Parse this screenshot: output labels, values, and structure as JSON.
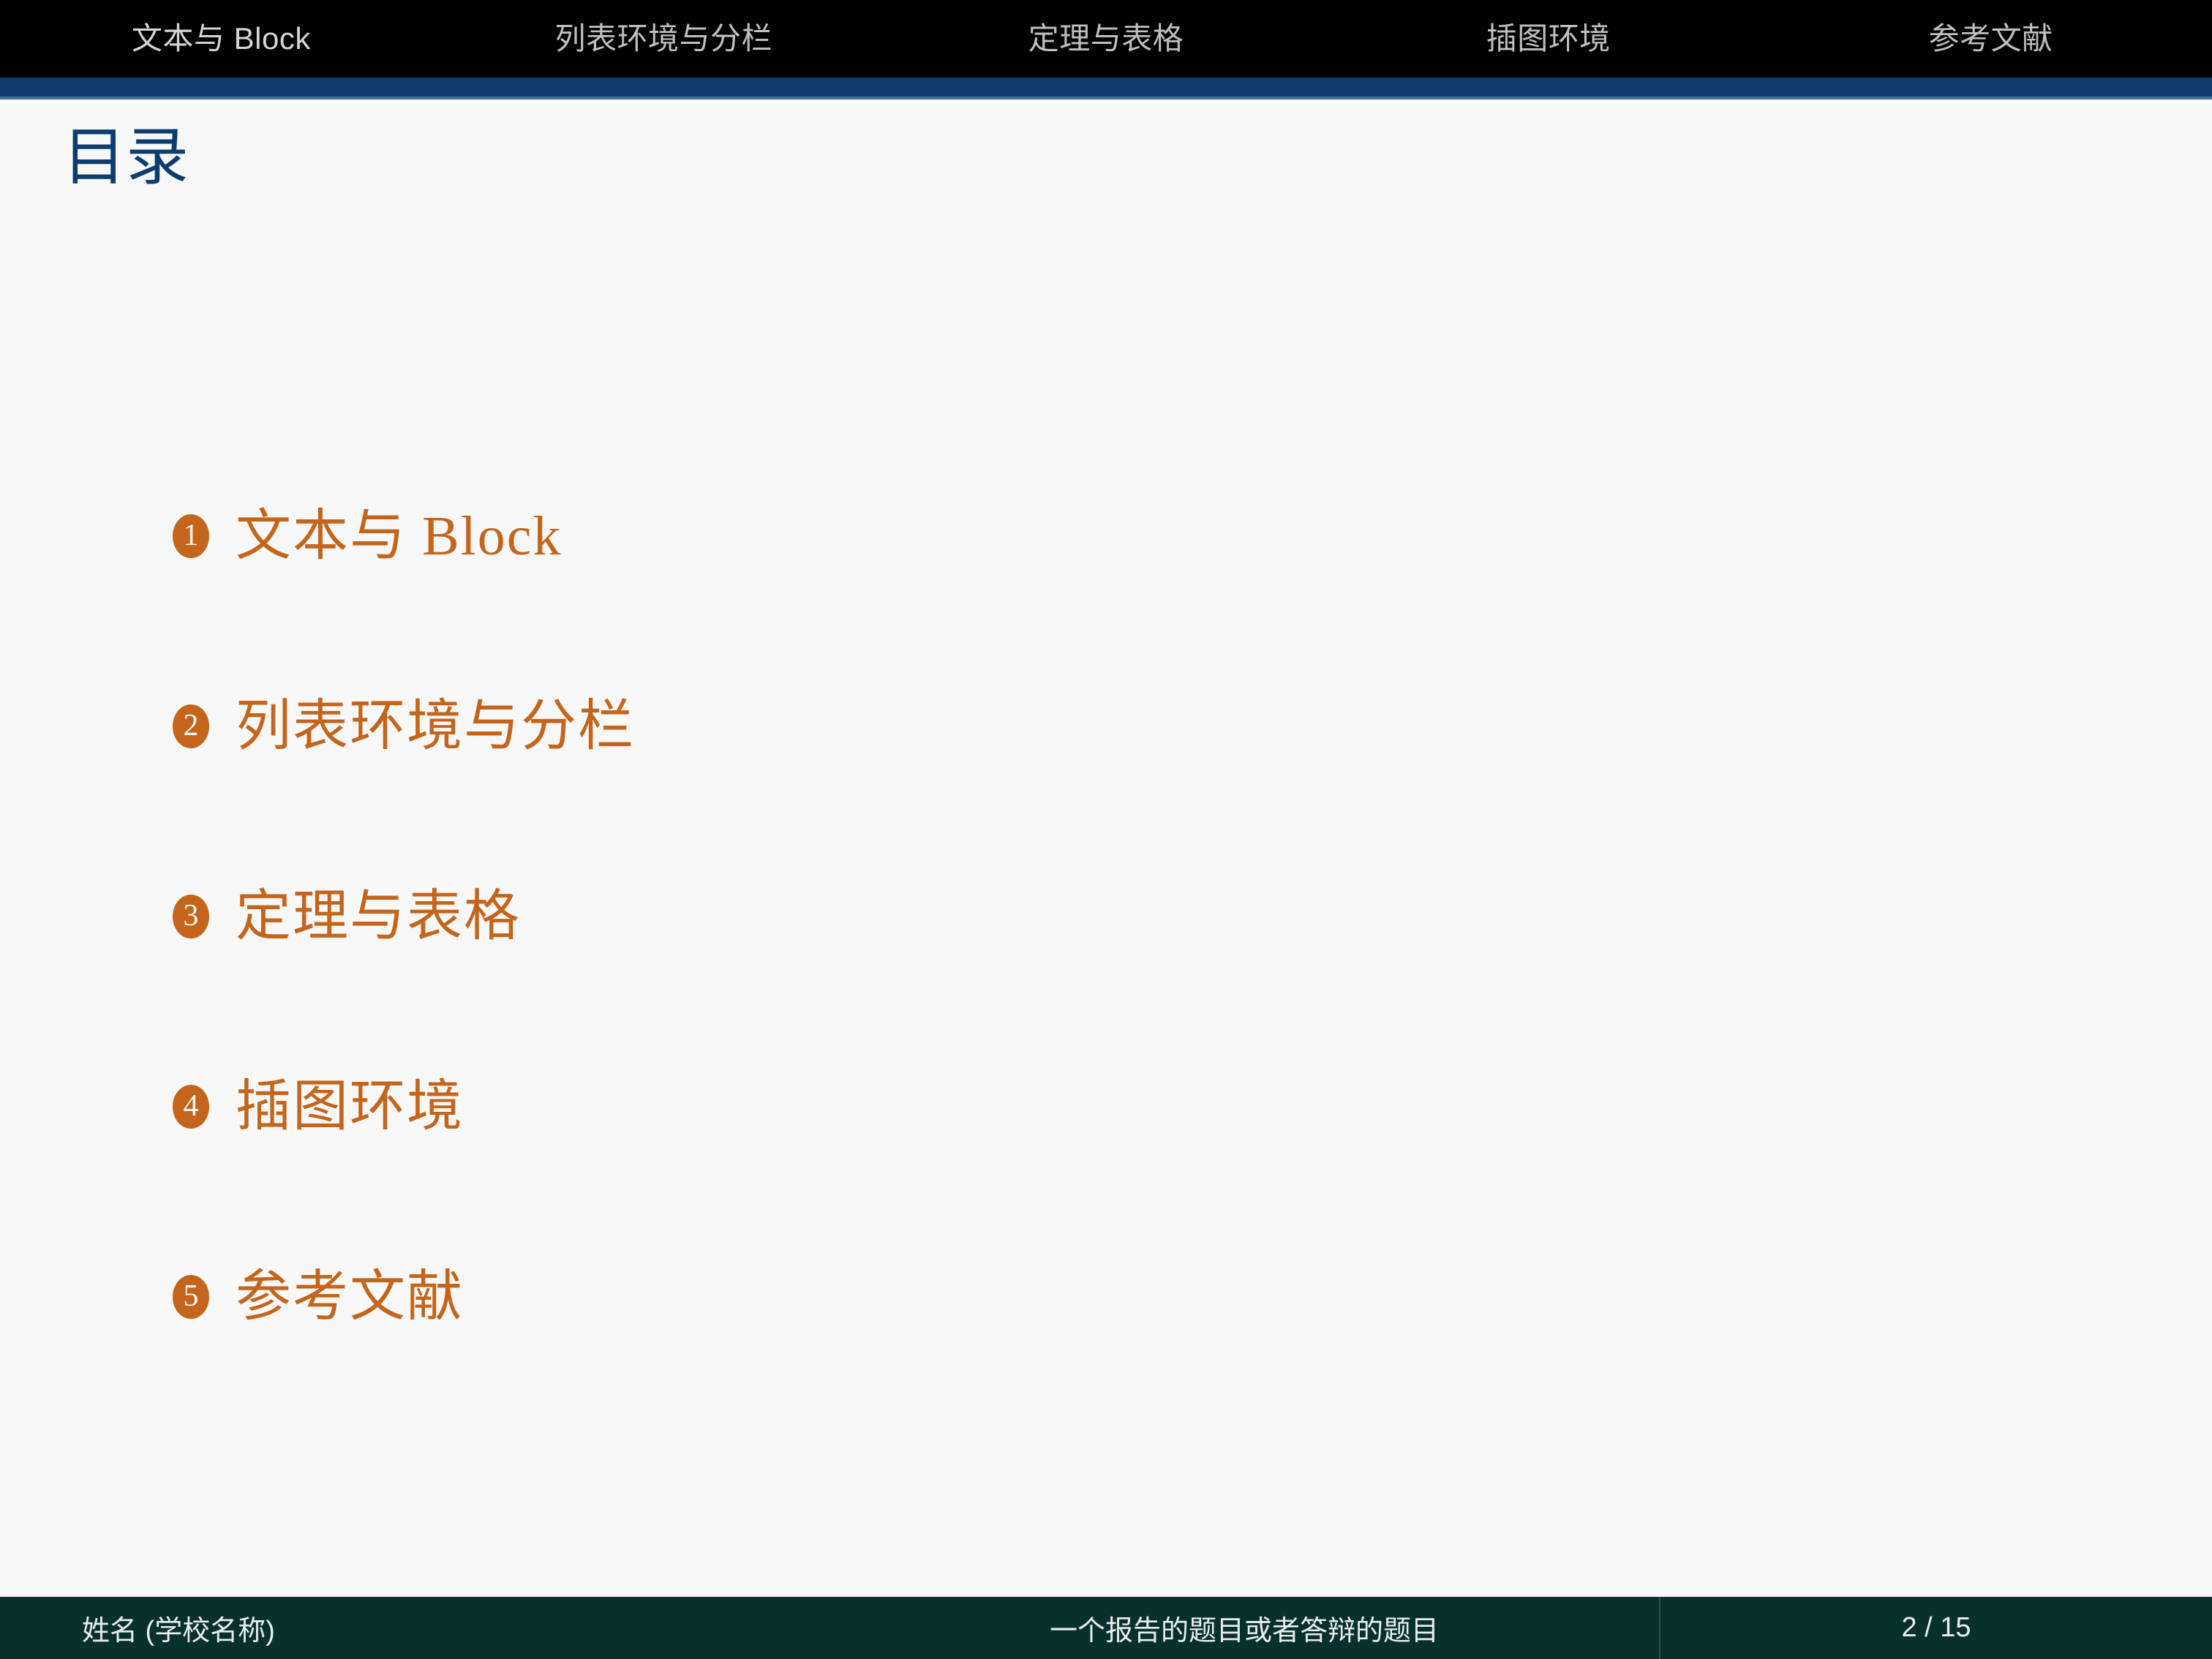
{
  "theme": {
    "background": "#f8f8f8",
    "navbar_bg": "#000000",
    "accent_blue": "#0d3d6e",
    "accent_orange": "#c4651b",
    "footer_bg": "#08302f",
    "nav_text": "#bfbfbf",
    "footer_text": "#e8eeee"
  },
  "navbar": {
    "items": [
      {
        "label": "文本与 Block"
      },
      {
        "label": "列表环境与分栏"
      },
      {
        "label": "定理与表格"
      },
      {
        "label": "插图环境"
      },
      {
        "label": "参考文献"
      }
    ]
  },
  "frame": {
    "title": "目录"
  },
  "toc": {
    "entries": [
      {
        "number": "1",
        "label": "文本与 Block"
      },
      {
        "number": "2",
        "label": "列表环境与分栏"
      },
      {
        "number": "3",
        "label": "定理与表格"
      },
      {
        "number": "4",
        "label": "插图环境"
      },
      {
        "number": "5",
        "label": "参考文献"
      }
    ]
  },
  "footline": {
    "author": "姓名 (学校名称)",
    "title": "一个报告的题目或者答辩的题目",
    "page": "2 / 15"
  }
}
